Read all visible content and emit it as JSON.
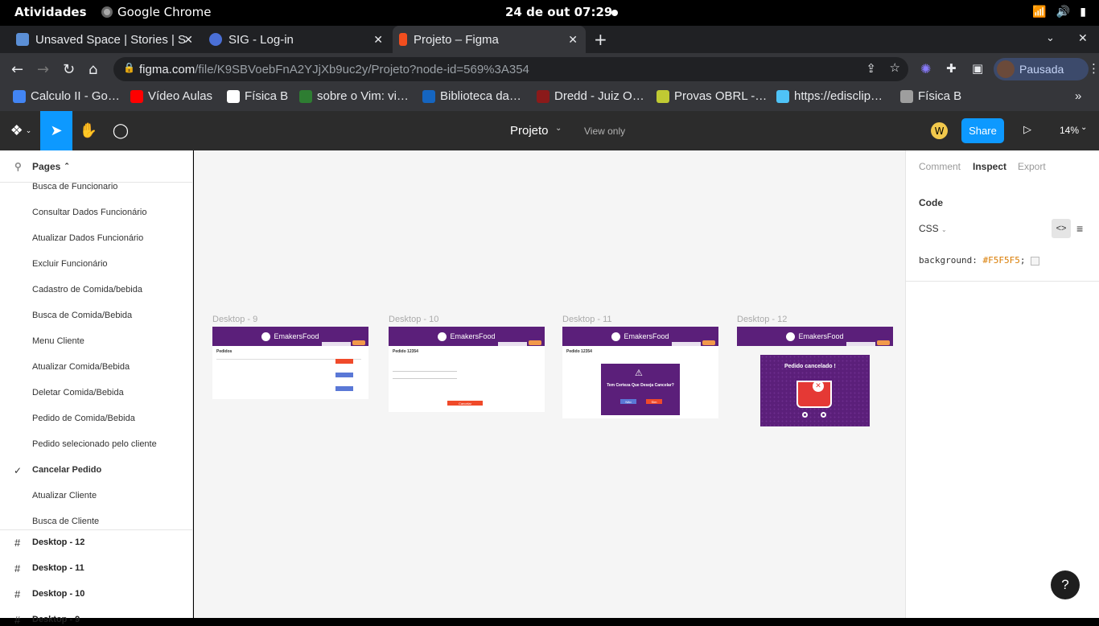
{
  "system_bar": {
    "activities": "Atividades",
    "app_name": "Google Chrome",
    "clock": "24 de out  07:29"
  },
  "tabs": [
    {
      "title": "Unsaved Space | Stories | S",
      "color": "#5b8fd6"
    },
    {
      "title": "SIG - Log-in",
      "color": "#4a6fd6"
    },
    {
      "title": "Projeto – Figma",
      "color": "#f24e1e"
    }
  ],
  "omnibox": {
    "domain": "figma.com",
    "path": "/file/K9SBVoebFnA2YJjXb9uc2y/Projeto?node-id=569%3A354",
    "profile_status": "Pausada"
  },
  "bookmarks": [
    {
      "label": "Calculo II - Go…",
      "color": "#4285f4"
    },
    {
      "label": "Vídeo Aulas",
      "color": "#ff0000"
    },
    {
      "label": "Física B",
      "color": "#ffffff"
    },
    {
      "label": "sobre o Vim: vi…",
      "color": "#2e7d32"
    },
    {
      "label": "Biblioteca da…",
      "color": "#1565c0"
    },
    {
      "label": "Dredd - Juiz O…",
      "color": "#8b1a1a"
    },
    {
      "label": "Provas OBRL -…",
      "color": "#c0ca33"
    },
    {
      "label": "https://edisclip…",
      "color": "#4fc3f7"
    },
    {
      "label": "Física B",
      "color": "#9e9e9e"
    }
  ],
  "figma_toolbar": {
    "file_name": "Projeto",
    "view_mode": "View only",
    "avatar_letter": "W",
    "share_label": "Share",
    "zoom": "14%"
  },
  "pages_panel": {
    "header": "Pages",
    "pages": [
      "Busca de Funcionario",
      "Consultar Dados Funcionário",
      "Atualizar Dados Funcionário",
      "Excluir Funcionário",
      "Cadastro de Comida/bebida",
      "Busca de Comida/Bebida",
      "Menu Cliente",
      "Atualizar Comida/Bebida",
      "Deletar Comida/Bebida",
      "Pedido de Comida/Bebida",
      "Pedido selecionado pelo cliente",
      "Cancelar Pedido",
      "Atualizar Cliente",
      "Busca de Cliente"
    ],
    "current_page": "Cancelar Pedido",
    "layers": [
      "Desktop - 12",
      "Desktop - 11",
      "Desktop - 10",
      "Desktop - 9"
    ]
  },
  "canvas": {
    "frames": [
      {
        "label": "Desktop - 9",
        "brand": "EmakersFood",
        "heading": "Pedidos"
      },
      {
        "label": "Desktop - 10",
        "brand": "EmakersFood",
        "heading": "Pedido 12354",
        "button": "Cancelar"
      },
      {
        "label": "Desktop - 11",
        "brand": "EmakersFood",
        "heading": "Pedido 12354",
        "dialog": "Tem Certeza Que Deseja Cancelar?",
        "no": "Não",
        "yes": "Sim"
      },
      {
        "label": "Desktop - 12",
        "brand": "EmakersFood",
        "message": "Pedido cancelado !"
      }
    ]
  },
  "inspect_panel": {
    "tabs": [
      "Comment",
      "Inspect",
      "Export"
    ],
    "active_tab": "Inspect",
    "code_header": "Code",
    "language": "CSS",
    "code_property": "background:",
    "code_value": "#F5F5F5",
    "code_end": ";"
  },
  "help_label": "?"
}
